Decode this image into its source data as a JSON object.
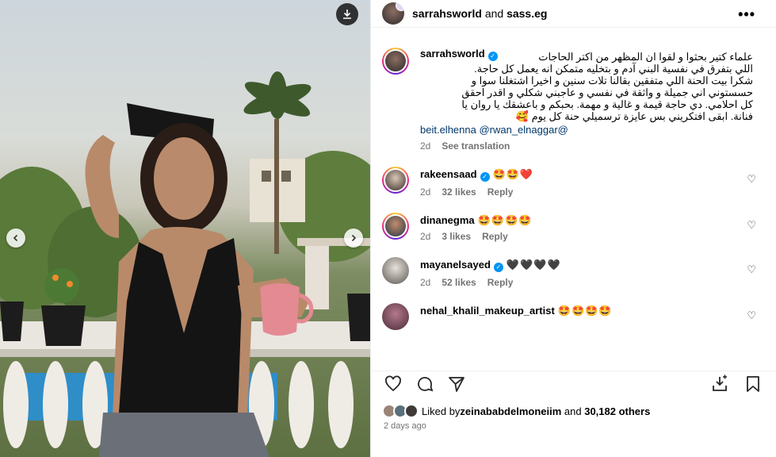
{
  "post": {
    "header_user": "sarrahsworld",
    "header_and": " and ",
    "header_collab": "sass.eg",
    "more_icon": "more-horizontal-icon"
  },
  "caption": {
    "username": "sarrahsworld",
    "text_lines": [
      "علماء كتير بحثوا و لقوا ان المظهر من اكتر الحاجات",
      "اللي بتفرق في نفسية البني آدم و بتخليه متمكن انه يعمل كل حاجة.",
      "شكرا بيت الحنة اللي متفقين بقالنا تلات سنين و اخيرا اشتغلنا سوا و",
      "حسستوني اني جميلة و واثقة في نفسي و عاجبني شكلي و اقدر احقق",
      "كل احلامي. دي حاجة قيمة و غالية و مهمة. بحبكم و باعشقك يا روان يا",
      "فنانة. ابقى افتكريني بس عايزة ترسميلي حنة كل يوم 🥰"
    ],
    "mentions": "beit.elhenna @rwan_elnaggar@",
    "age": "2d",
    "translate": "See translation"
  },
  "comments": [
    {
      "username": "rakeensaad",
      "verified": true,
      "text": "🤩🤩❤️",
      "age": "2d",
      "likes": "32 likes",
      "reply": "Reply"
    },
    {
      "username": "dinanegma",
      "verified": false,
      "text": "🤩🤩🤩🤩",
      "age": "2d",
      "likes": "3 likes",
      "reply": "Reply"
    },
    {
      "username": "mayanelsayed",
      "verified": true,
      "text": "🖤🖤🖤🖤",
      "age": "2d",
      "likes": "52 likes",
      "reply": "Reply"
    },
    {
      "username": "nehal_khalil_makeup_artist",
      "verified": false,
      "text": "🤩🤩🤩🤩",
      "age": "",
      "likes": "",
      "reply": ""
    }
  ],
  "likes": {
    "prefix": "Liked by ",
    "user": "zeinababdelmoneiim",
    "middle": " and ",
    "count": "30,182 others"
  },
  "date": "2 days ago",
  "colors": {
    "accent": "#0095f6",
    "link": "#00376b",
    "muted": "#737373"
  }
}
